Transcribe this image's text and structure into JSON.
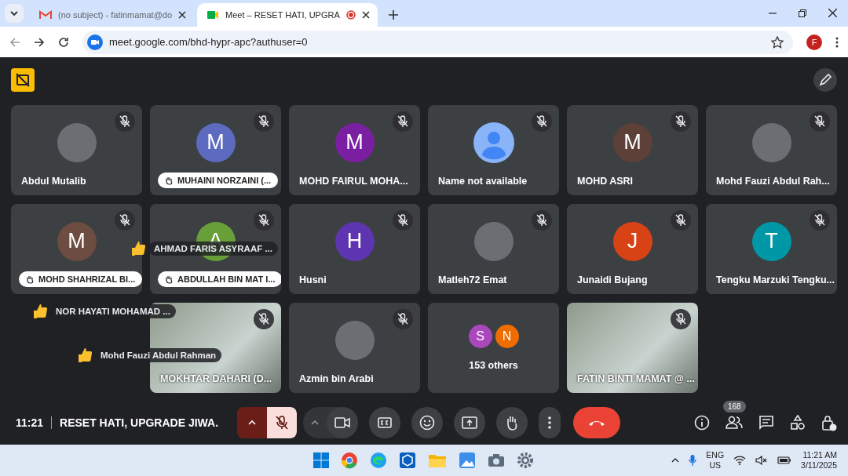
{
  "browser": {
    "tabs": [
      {
        "title": "(no subject) - fatinmamat@do",
        "kind": "mail",
        "selected": false,
        "recording": false
      },
      {
        "title": "Meet – RESET HATI, UPGRA",
        "kind": "meet",
        "selected": true,
        "recording": true
      }
    ],
    "address": "meet.google.com/bhd-hypr-apc?authuser=0",
    "profile_initial": "F"
  },
  "tiles": [
    {
      "kind": "photo",
      "name": "Abdul Mutalib",
      "muted": true,
      "hand_raised": false
    },
    {
      "kind": "initial",
      "initial": "M",
      "color": "#5c6bc0",
      "name": "MUHAINI NORZAINI (...",
      "muted": true,
      "hand_raised": true
    },
    {
      "kind": "initial",
      "initial": "M",
      "color": "#7b1fa2",
      "name": "MOHD FAIRUL MOHA...",
      "muted": true,
      "hand_raised": false
    },
    {
      "kind": "silhouette",
      "name": "Name not available",
      "muted": true,
      "hand_raised": false
    },
    {
      "kind": "initial",
      "initial": "M",
      "color": "#5d4037",
      "name": "MOHD ASRI",
      "muted": true,
      "hand_raised": false
    },
    {
      "kind": "photo",
      "name": "Mohd Fauzi Abdul Rah...",
      "muted": true,
      "hand_raised": false
    },
    {
      "kind": "initial",
      "initial": "M",
      "color": "#6d4c41",
      "name": "MOHD SHAHRIZAL BI...",
      "muted": true,
      "hand_raised": true
    },
    {
      "kind": "initial",
      "initial": "A",
      "color": "#689f38",
      "name": "ABDULLAH BIN MAT I...",
      "muted": true,
      "hand_raised": true
    },
    {
      "kind": "initial",
      "initial": "H",
      "color": "#5e35b1",
      "name": "Husni",
      "muted": true,
      "hand_raised": false
    },
    {
      "kind": "photo",
      "name": "Matleh72 Emat",
      "muted": true,
      "hand_raised": false
    },
    {
      "kind": "initial",
      "initial": "J",
      "color": "#d84315",
      "name": "Junaidi Bujang",
      "muted": true,
      "hand_raised": false
    },
    {
      "kind": "initial",
      "initial": "T",
      "color": "#0097a7",
      "name": "Tengku Marzuki Tengku...",
      "muted": true,
      "hand_raised": false
    },
    {
      "kind": "empty",
      "muted": false,
      "hand_raised": false
    },
    {
      "kind": "video",
      "name": "MOKHTAR DAHARI (D...",
      "muted": true,
      "hand_raised": false
    },
    {
      "kind": "photo",
      "name": "Azmin bin Arabi",
      "muted": true,
      "hand_raised": false
    },
    {
      "kind": "others",
      "name": "153 others",
      "initials": [
        {
          "initial": "S",
          "color": "#ab47bc"
        },
        {
          "initial": "N",
          "color": "#ef6c00"
        }
      ],
      "muted": false,
      "hand_raised": false
    },
    {
      "kind": "video",
      "name": "FATIN BINTI MAMAT @ ...",
      "muted": true,
      "hand_raised": false
    }
  ],
  "reactions": [
    {
      "name": "AHMAD FARIS ASYRAAF ..."
    },
    {
      "name": "NOR HAYATI MOHAMAD ..."
    },
    {
      "name": "Mohd Fauzi Abdul Rahman"
    }
  ],
  "call_bar": {
    "time": "11:21",
    "meeting_title": "RESET HATI, UPGRADE JIWA.",
    "mic_muted": true,
    "people_count": "168"
  },
  "taskbar": {
    "language": "ENG",
    "region": "US",
    "time": "11:21 AM",
    "date": "3/11/2025"
  }
}
